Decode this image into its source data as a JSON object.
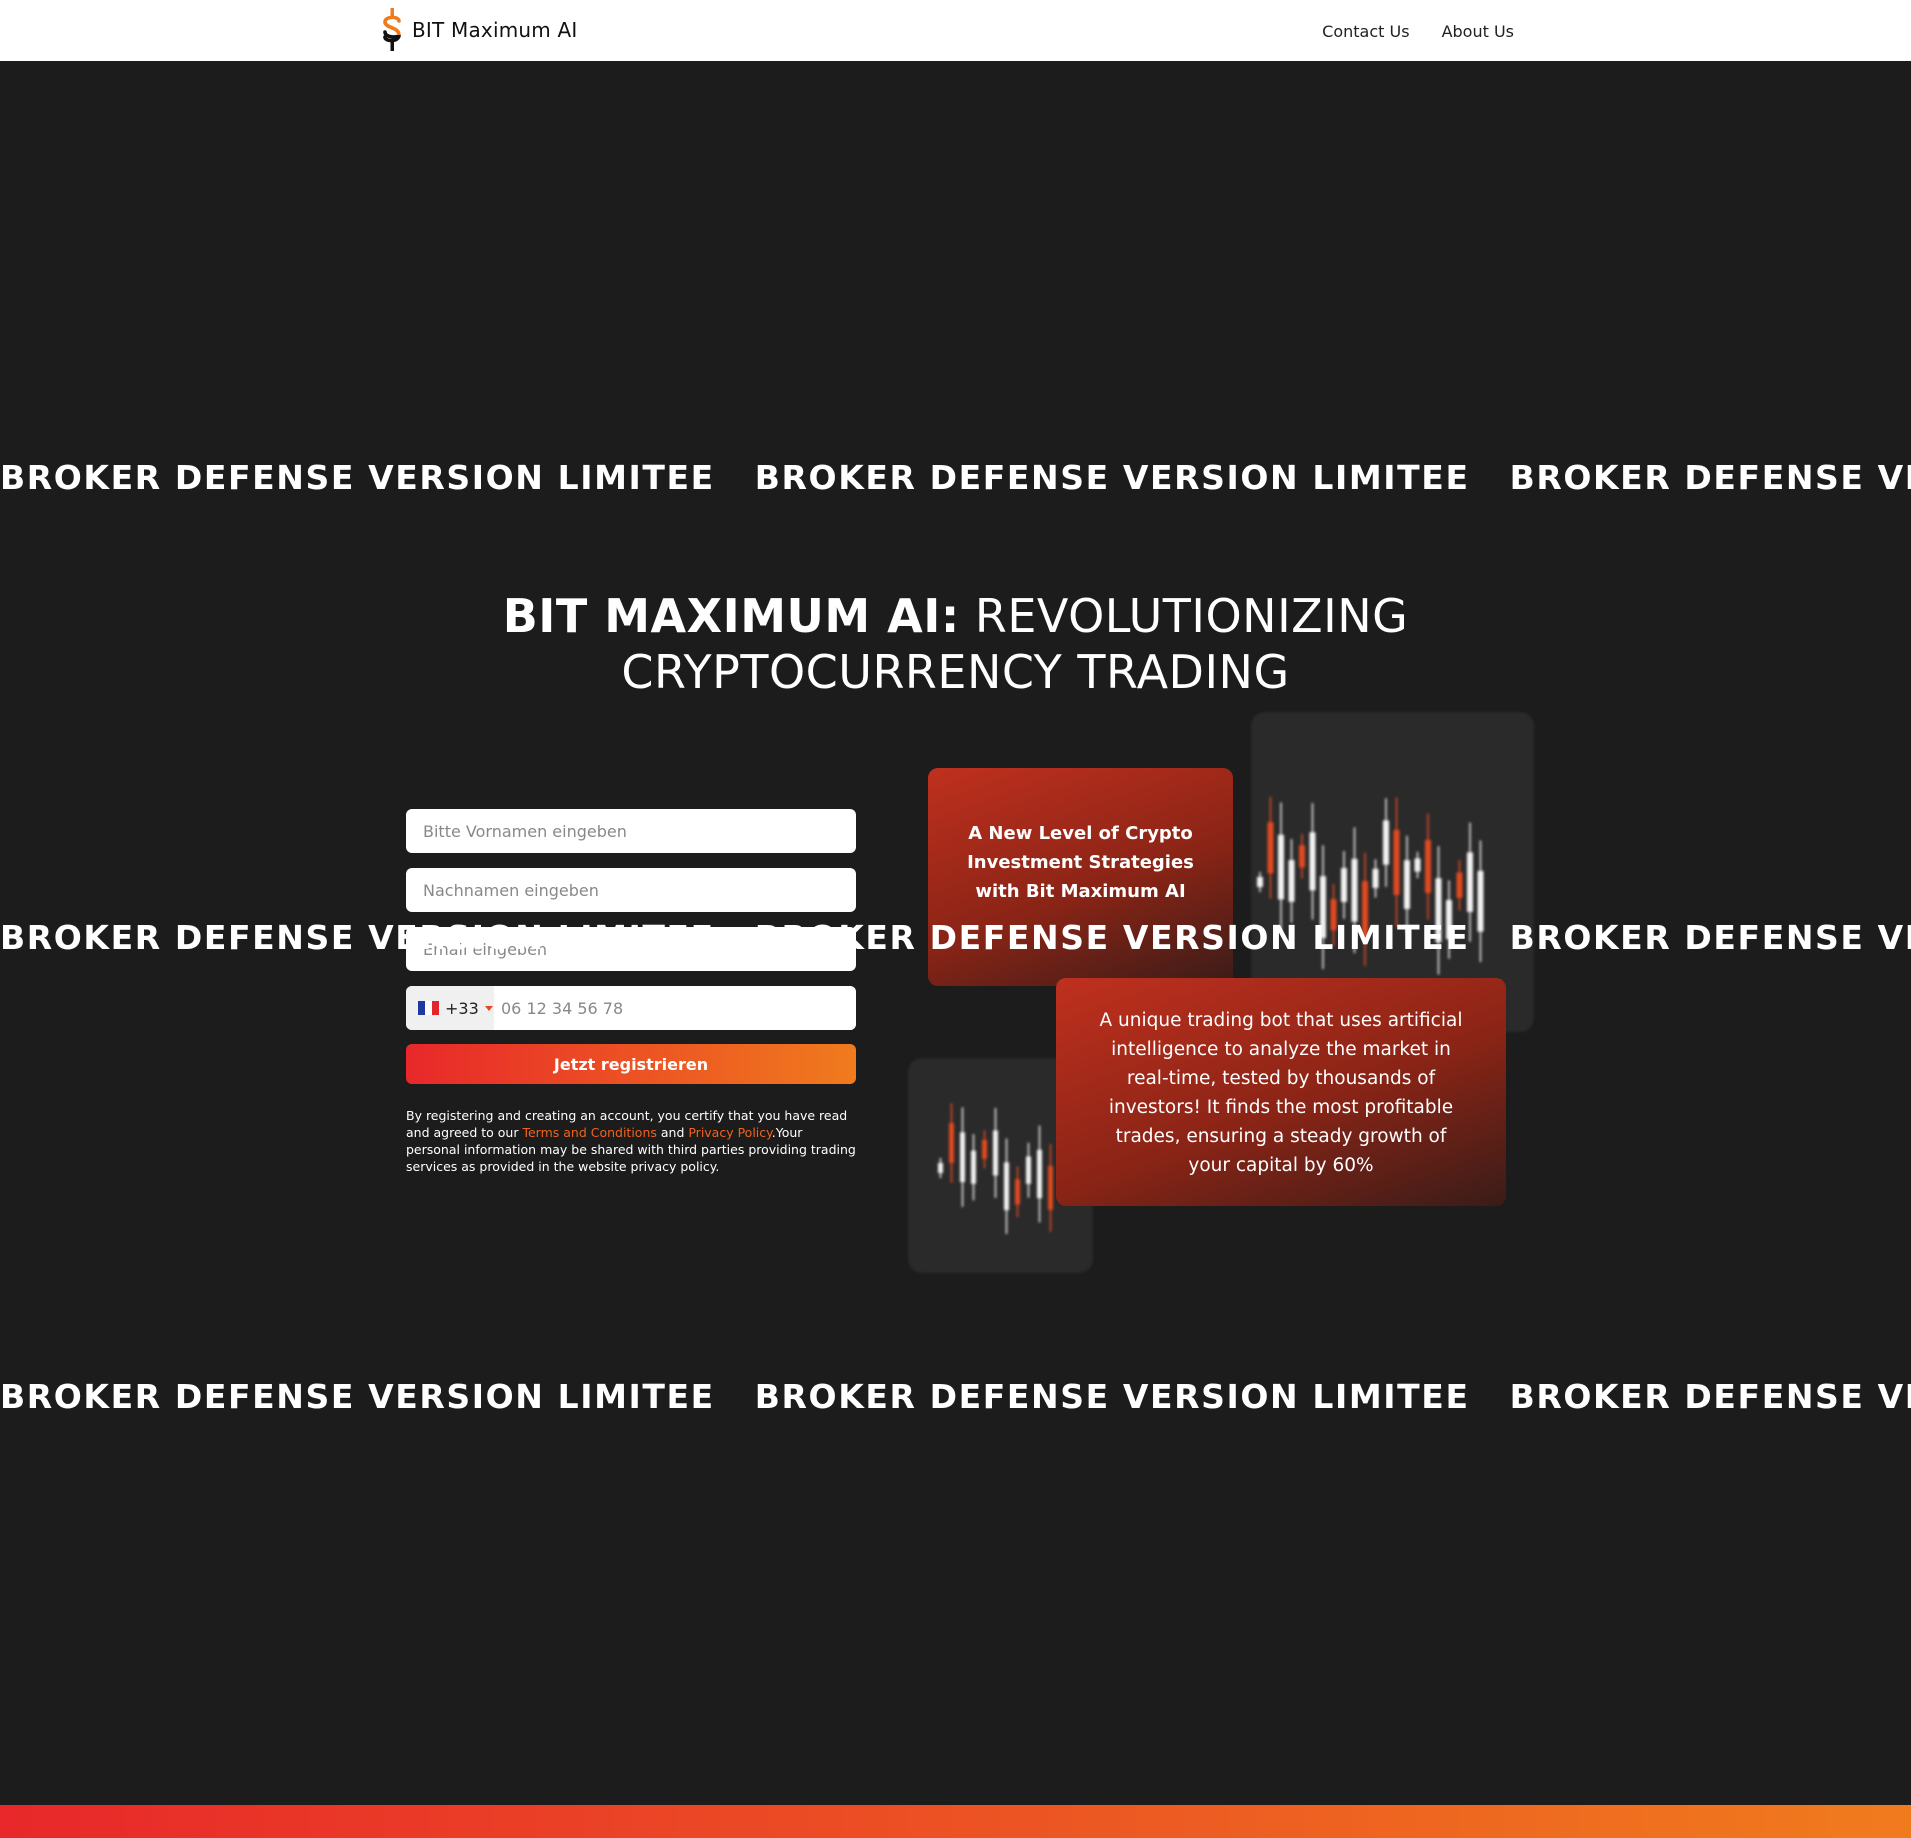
{
  "header": {
    "brand": "BIT Maximum AI",
    "nav": [
      "Contact Us",
      "About Us"
    ]
  },
  "ticker": {
    "text": "BROKER DEFENSE VERSION LIMITEE"
  },
  "hero": {
    "headline_bold": "BIT MAXIMUM AI:",
    "headline_line1_rest": "REVOLUTIONIZING",
    "headline_line2": "CRYPTOCURRENCY TRADING"
  },
  "form": {
    "first_name_placeholder": "Bitte Vornamen eingeben",
    "last_name_placeholder": "Nachnamen eingeben",
    "email_placeholder": "Email eingeben",
    "dial_code": "+33",
    "phone_placeholder": "06 12 34 56 78",
    "submit_label": "Jetzt registrieren",
    "disclaimer_part1": "By registering and creating an account, you certify that you have read and agreed to our ",
    "terms_link": "Terms and Conditions",
    "disclaimer_and": " and ",
    "privacy_link": "Privacy Policy",
    "disclaimer_part2": ".Your personal information may be shared with third parties providing trading services as provided in the website privacy policy."
  },
  "cards": {
    "card1": "A New Level of Crypto Investment Strategies with Bit Maximum AI",
    "card2": "A unique trading bot that uses artificial intelligence to analyze the market in real-time, tested by thousands of investors! It finds the most profitable trades, ensuring a steady growth of your capital by 60%"
  },
  "colors": {
    "background": "#1c1c1c",
    "accent_start": "#e8282a",
    "accent_end": "#f07b1d",
    "link": "#f2621e"
  }
}
